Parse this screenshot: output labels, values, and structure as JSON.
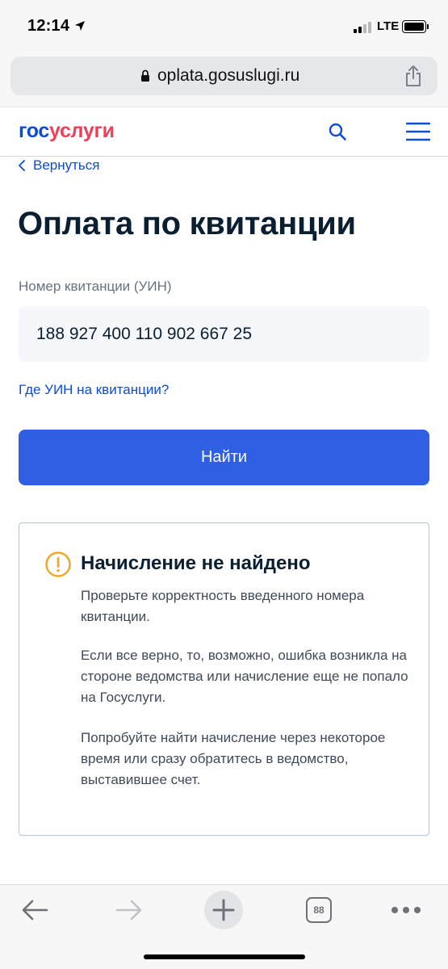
{
  "status_bar": {
    "time": "12:14",
    "network": "LTE",
    "icons": [
      "location-arrow-icon",
      "signal-icon",
      "battery-icon"
    ]
  },
  "browser": {
    "url": "oplata.gosuslugi.ru",
    "icons": [
      "lock-icon",
      "share-icon"
    ]
  },
  "header": {
    "logo_part1": "гос",
    "logo_part2": "услуги",
    "icons": [
      "search-icon",
      "menu-icon"
    ],
    "brand_blue": "#0d4cd3",
    "brand_red": "#ee3f58"
  },
  "page": {
    "back_label": "Вернуться",
    "title": "Оплата по квитанции",
    "field_label": "Номер квитанции (УИН)",
    "field_value": "188 927 400 110 902 667 25",
    "help_link": "Где УИН на квитанции?",
    "find_button": "Найти",
    "button_color": "#2f5fe3"
  },
  "notice": {
    "icon": "warning-icon",
    "accent_color": "#f0a52b",
    "title": "Начисление не найдено",
    "p1": "Проверьте корректность введенного номера квитанции.",
    "p2": "Если все верно, то, возможно, ошибка возникла на стороне ведомства или начисление еще не попало на Госуслуги.",
    "p3": "Попробуйте найти начисление через некоторое время или сразу обратитесь в ведомство, выставившее счет."
  },
  "toolbar": {
    "tab_count": "88",
    "icons": [
      "back-arrow-icon",
      "forward-arrow-icon",
      "plus-icon",
      "tabs-icon",
      "more-icon"
    ]
  }
}
